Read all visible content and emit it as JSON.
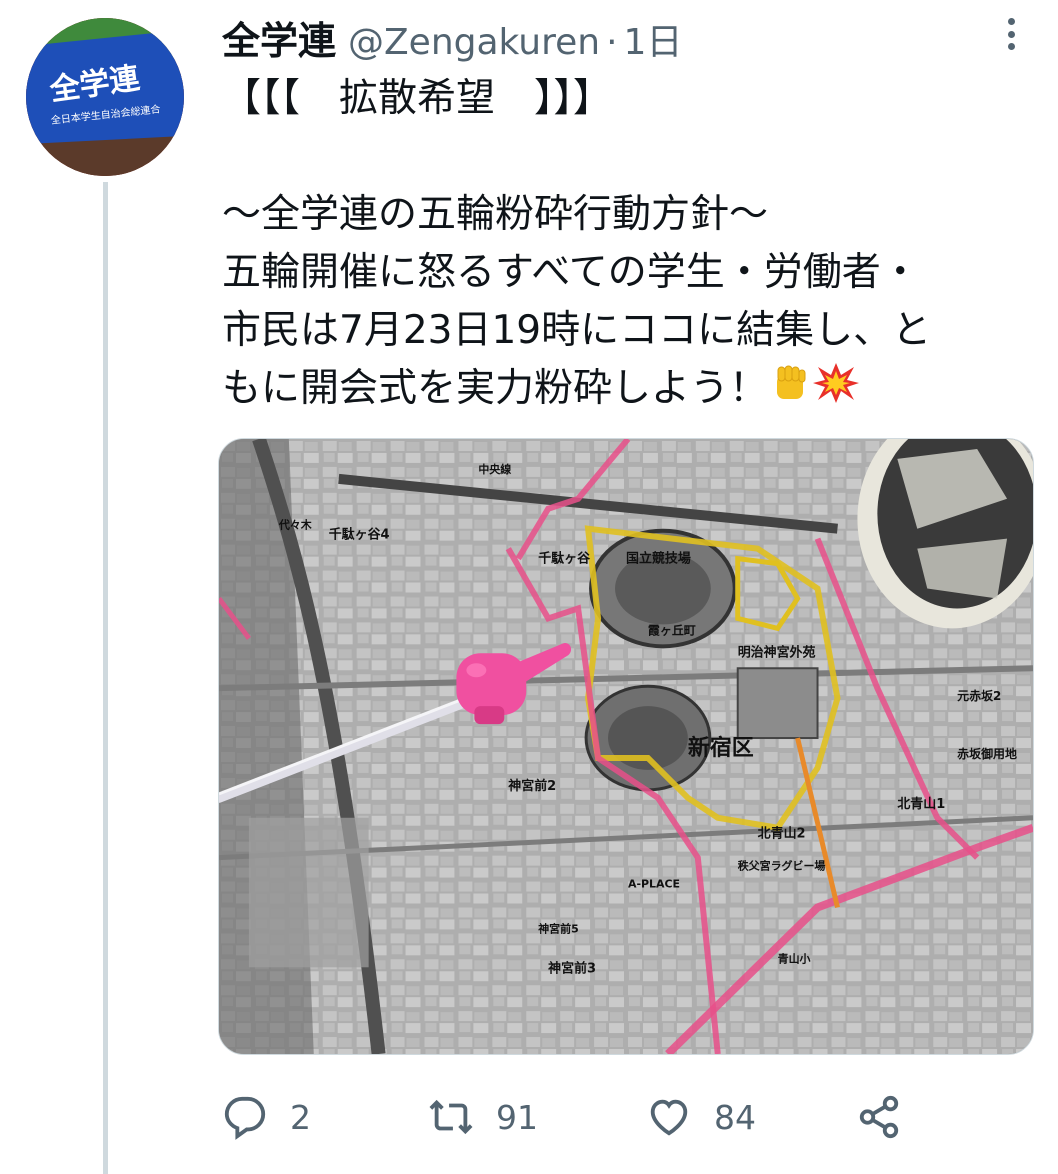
{
  "tweet": {
    "author_name": "全学連",
    "handle": "@Zengakuren",
    "separator": "·",
    "time": "1日",
    "avatar_banner_text": "全学連",
    "avatar_banner_subtext": "全日本学生自治会総連合",
    "lines": [
      "【【【　拡散希望　】】】",
      "",
      "〜全学連の五輪粉砕行動方針〜",
      "五輪開催に怒るすべての学生・労働者・",
      "市民は7月23日19時にココに結集し、と",
      "もに開会式を実力粉砕しよう！"
    ],
    "emojis": [
      "✊",
      "💥"
    ]
  },
  "map": {
    "labels": [
      "国立競技場",
      "霞ヶ丘町",
      "新宿区",
      "明治神宮外苑",
      "千駄ヶ谷",
      "神宮前2",
      "神宮前3",
      "北青山1",
      "北青山2",
      "赤坂御用地",
      "元赤坂2",
      "千駄ヶ谷4",
      "代々木",
      "神宮前5",
      "青山小",
      "秩父宮ラグビー場",
      "A-PLACE",
      "中央線"
    ]
  },
  "actions": {
    "reply_count": "2",
    "retweet_count": "91",
    "like_count": "84"
  },
  "colors": {
    "text_primary": "#0f1419",
    "text_secondary": "#536471",
    "divider": "#cfd9de",
    "route_pink": "#e8508a",
    "zone_yellow": "#e0c020",
    "emoji_fist": "#f4c020"
  }
}
